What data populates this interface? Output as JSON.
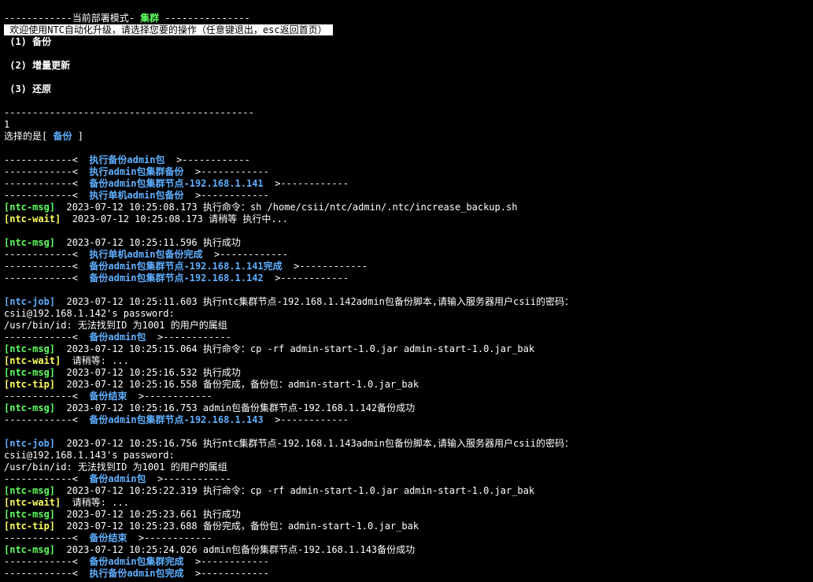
{
  "header": {
    "prefix": "------------当前部署模式- ",
    "mode": "集群",
    "suffix": " ---------------",
    "welcome": " 欢迎使用NTC自动化升级，请选择您要的操作（任意键退出，esc返回首页） "
  },
  "menu": [
    " (1) 备份",
    " (2) 增量更新",
    " (3) 还原"
  ],
  "separator": "--------------------------------------------",
  "input": "1",
  "selection": {
    "prefix": "选择的是[ ",
    "value": "备份",
    "suffix": " ]"
  },
  "block1": {
    "a1": "执行备份admin包",
    "a2": "执行admin包集群备份",
    "a3": "备份admin包集群节点-192.168.1.141",
    "a4": "执行单机admin包备份",
    "log1": "2023-07-12 10:25:08.173 执行命令：sh /home/csii/ntc/admin/.ntc/increase_backup.sh",
    "log2": "2023-07-12 10:25:08.173 请稍等 执行中...",
    "log3": "2023-07-12 10:25:11.596 执行成功",
    "b1": "执行单机admin包备份完成",
    "b2": "备份admin包集群节点-192.168.1.141完成",
    "b3": "备份admin包集群节点-192.168.1.142"
  },
  "node142": {
    "job": "2023-07-12 10:25:11.603 执行ntc集群节点-192.168.1.142admin包备份脚本,请输入服务器用户csii的密码：",
    "pw": "csii@192.168.1.142's password:",
    "id": "/usr/bin/id: 无法找到ID 为1001 的用户的属组",
    "a1": "备份admin包",
    "m1": "2023-07-12 10:25:15.064 执行命令：cp -rf admin-start-1.0.jar admin-start-1.0.jar_bak",
    "w1": "请稍等: ...",
    "m2": "2023-07-12 10:25:16.532 执行成功",
    "t1": "2023-07-12 10:25:16.558 备份完成，备份包：admin-start-1.0.jar_bak",
    "a2": "备份结束",
    "m3": "2023-07-12 10:25:16.753 admin包备份集群节点-192.168.1.142备份成功",
    "a3": "备份admin包集群节点-192.168.1.143"
  },
  "node143": {
    "job": "2023-07-12 10:25:16.756 执行ntc集群节点-192.168.1.143admin包备份脚本,请输入服务器用户csii的密码：",
    "pw": "csii@192.168.1.143's password:",
    "id": "/usr/bin/id: 无法找到ID 为1001 的用户的属组",
    "a1": "备份admin包",
    "m1": "2023-07-12 10:25:22.319 执行命令：cp -rf admin-start-1.0.jar admin-start-1.0.jar_bak",
    "w1": "请稍等: ...",
    "m2": "2023-07-12 10:25:23.661 执行成功",
    "t1": "2023-07-12 10:25:23.688 备份完成，备份包：admin-start-1.0.jar_bak",
    "a2": "备份结束",
    "m3": "2023-07-12 10:25:24.026 admin包备份集群节点-192.168.1.143备份成功",
    "a3": "备份admin包集群完成",
    "a4": "执行备份admin包完成"
  },
  "tags": {
    "msg": "[ntc-msg]",
    "wait": "[ntc-wait]",
    "job": "[ntc-job]",
    "tip": "[ntc-tip]",
    "arrow_left": "------------<  ",
    "arrow_right": "  >------------"
  },
  "colors": {
    "background": "#000000",
    "green": "#5fff5f",
    "yellow": "#ffff5f",
    "blue": "#5fafff"
  }
}
